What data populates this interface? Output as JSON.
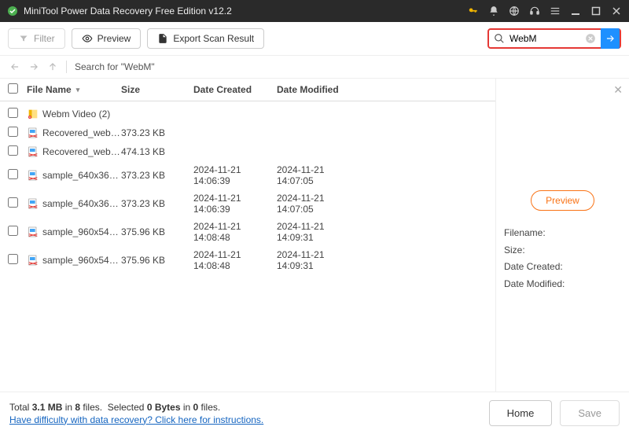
{
  "title": "MiniTool Power Data Recovery Free Edition v12.2",
  "toolbar": {
    "filter": "Filter",
    "preview": "Preview",
    "export": "Export Scan Result"
  },
  "search": {
    "value": "WebM",
    "placeholder": "Search"
  },
  "breadcrumb": {
    "label": "Search for  \"WebM\""
  },
  "columns": {
    "name": "File Name",
    "size": "Size",
    "created": "Date Created",
    "modified": "Date Modified"
  },
  "rows": [
    {
      "type": "folder",
      "name": "Webm Video (2)",
      "size": "",
      "created": "",
      "modified": ""
    },
    {
      "type": "file",
      "name": "Recovered_webm...",
      "size": "373.23 KB",
      "created": "",
      "modified": ""
    },
    {
      "type": "file",
      "name": "Recovered_webm...",
      "size": "474.13 KB",
      "created": "",
      "modified": ""
    },
    {
      "type": "file",
      "name": "sample_640x360...",
      "size": "373.23 KB",
      "created": "2024-11-21 14:06:39",
      "modified": "2024-11-21 14:07:05"
    },
    {
      "type": "file",
      "name": "sample_640x360...",
      "size": "373.23 KB",
      "created": "2024-11-21 14:06:39",
      "modified": "2024-11-21 14:07:05"
    },
    {
      "type": "file",
      "name": "sample_960x540...",
      "size": "375.96 KB",
      "created": "2024-11-21 14:08:48",
      "modified": "2024-11-21 14:09:31"
    },
    {
      "type": "file",
      "name": "sample_960x540...",
      "size": "375.96 KB",
      "created": "2024-11-21 14:08:48",
      "modified": "2024-11-21 14:09:31"
    }
  ],
  "preview": {
    "button": "Preview",
    "filename_label": "Filename:",
    "size_label": "Size:",
    "created_label": "Date Created:",
    "modified_label": "Date Modified:"
  },
  "footer": {
    "total_prefix": "Total ",
    "total_size": "3.1 MB",
    "total_mid": " in ",
    "total_files": "8",
    "total_suffix": " files.",
    "sel_prefix": "Selected ",
    "sel_size": "0 Bytes",
    "sel_mid": " in ",
    "sel_files": "0",
    "sel_suffix": " files.",
    "help_link": "Have difficulty with data recovery? Click here for instructions.",
    "home": "Home",
    "save": "Save"
  }
}
